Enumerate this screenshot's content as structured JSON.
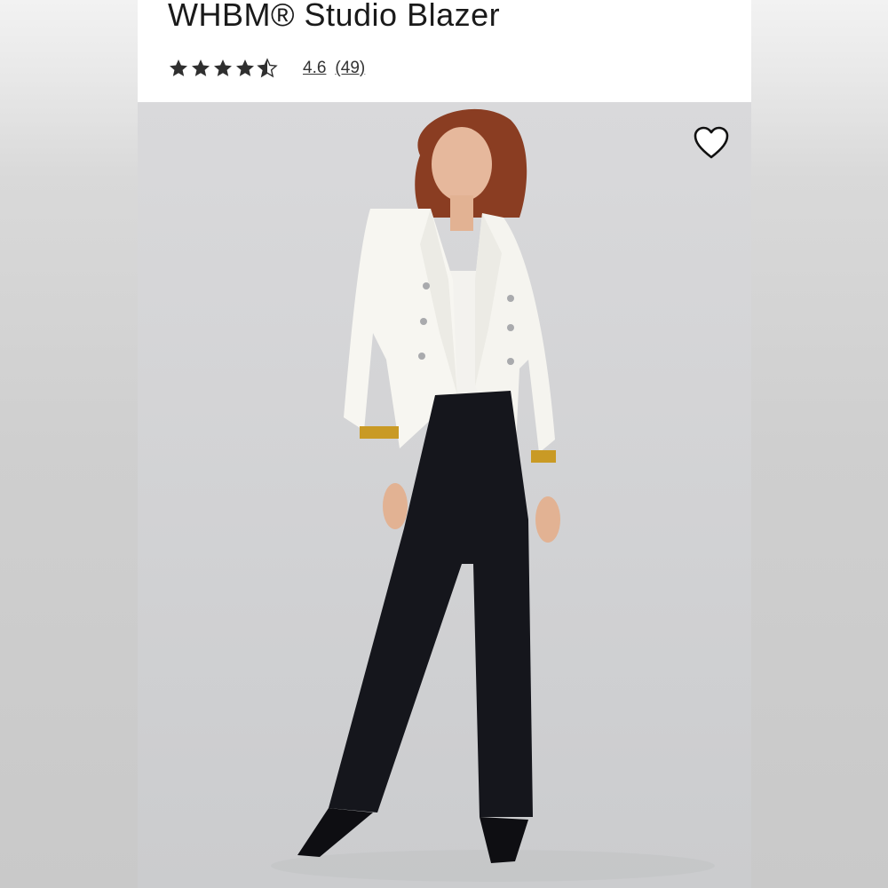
{
  "product": {
    "title": "WHBM® Studio Blazer",
    "rating": {
      "value": "4.6",
      "count": "(49)",
      "stars": 4.5,
      "max_stars": 5
    }
  },
  "image": {
    "description_icon": "model-photo",
    "favorite_icon": "heart-outline-icon"
  },
  "colors": {
    "title": "#1a1a1a",
    "star": "#2f2f2f",
    "photo_background": "#d3d4d6"
  }
}
